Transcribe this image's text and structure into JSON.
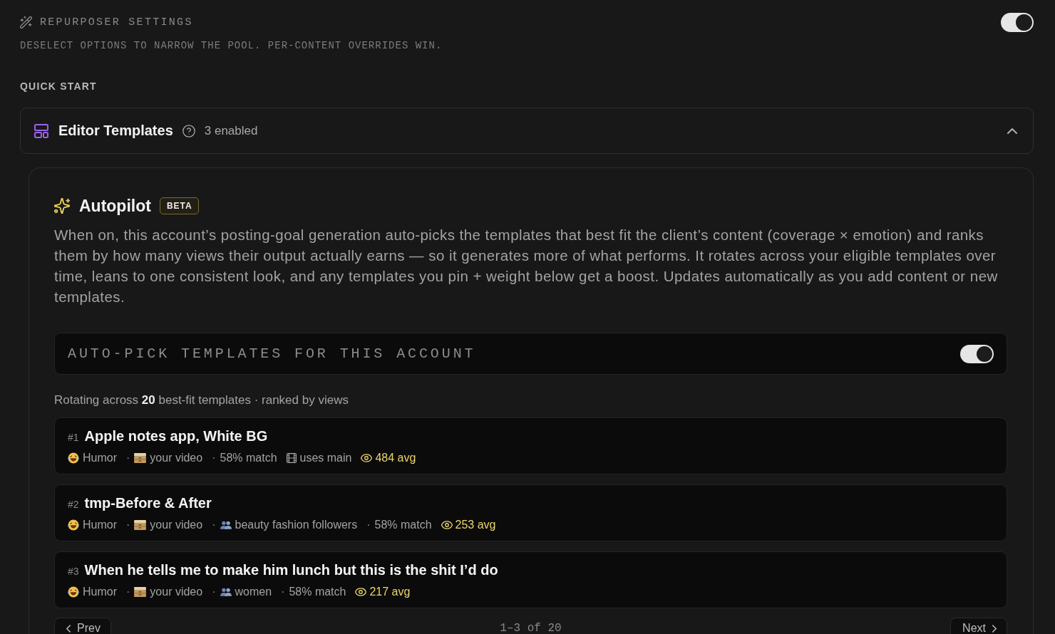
{
  "header": {
    "title": "REPURPOSER SETTINGS",
    "subtitle": "DESELECT OPTIONS TO NARROW THE POOL. PER-CONTENT OVERRIDES WIN.",
    "toggle": {
      "on": true
    }
  },
  "section_label": "QUICK START",
  "editor_templates": {
    "title": "Editor Templates",
    "count": "3 enabled",
    "expanded": true
  },
  "autopilot": {
    "title": "Autopilot",
    "badge": "BETA",
    "description": "When on, this account’s posting-goal generation auto-picks the templates that best fit the client’s content (coverage × emotion) and ranks them by how many views their output actually earns — so it generates more of what performs. It rotates across your eligible templates over time, leans to one consistent look, and any templates you pin + weight below get a boost. Updates automatically as you add content or new templates.",
    "auto_pick": {
      "label": "AUTO-PICK TEMPLATES FOR THIS ACCOUNT",
      "on": true
    },
    "summary": "Rotating across **20** best-fit templates · ranked by views",
    "templates": [
      {
        "rank": "#1",
        "title": "Apple notes app, White BG",
        "meta": [
          {
            "kind": "emotion",
            "text": "Humor"
          },
          {
            "kind": "source",
            "sep": "·",
            "text": "your video"
          },
          {
            "kind": "match",
            "sep": "·",
            "text": "58% match"
          },
          {
            "kind": "main",
            "text": "uses main"
          },
          {
            "kind": "views",
            "text": "484 avg"
          }
        ]
      },
      {
        "rank": "#2",
        "title": "tmp-Before & After",
        "meta": [
          {
            "kind": "emotion",
            "text": "Humor"
          },
          {
            "kind": "source",
            "sep": "·",
            "text": "your video"
          },
          {
            "kind": "audience",
            "sep": "·",
            "text": "beauty fashion followers"
          },
          {
            "kind": "match",
            "sep": "·",
            "text": "58% match"
          },
          {
            "kind": "views",
            "text": "253 avg"
          }
        ]
      },
      {
        "rank": "#3",
        "title": "When he tells me to make him lunch but this is the shit I’d do",
        "meta": [
          {
            "kind": "emotion",
            "text": "Humor"
          },
          {
            "kind": "source",
            "sep": "·",
            "text": "your video"
          },
          {
            "kind": "audience",
            "sep": "·",
            "text": "women"
          },
          {
            "kind": "match",
            "sep": "·",
            "text": "58% match"
          },
          {
            "kind": "views",
            "text": "217 avg"
          }
        ]
      }
    ],
    "pagination": {
      "prev": "Prev",
      "range": "1–3 of 20",
      "next": "Next"
    }
  }
}
